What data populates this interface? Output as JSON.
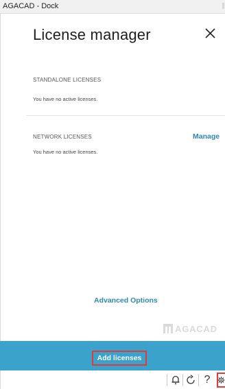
{
  "window": {
    "title": "AGACAD - Dock"
  },
  "panel": {
    "heading": "License manager",
    "standalone": {
      "title": "STANDALONE LICENSES",
      "status": "You have no active licenses."
    },
    "network": {
      "title": "NETWORK LICENSES",
      "status": "You have no active licenses.",
      "manage_label": "Manage"
    },
    "advanced_label": "Advanced Options",
    "logo_text": "AGACAD",
    "add_licenses_label": "Add licenses"
  },
  "toolbar": {
    "icons": [
      "bell-icon",
      "refresh-icon",
      "help-icon",
      "gear-icon"
    ],
    "help_glyph": "?"
  },
  "colors": {
    "accent": "#3ba2cb",
    "link": "#2e88b5",
    "highlight": "#e53935"
  }
}
